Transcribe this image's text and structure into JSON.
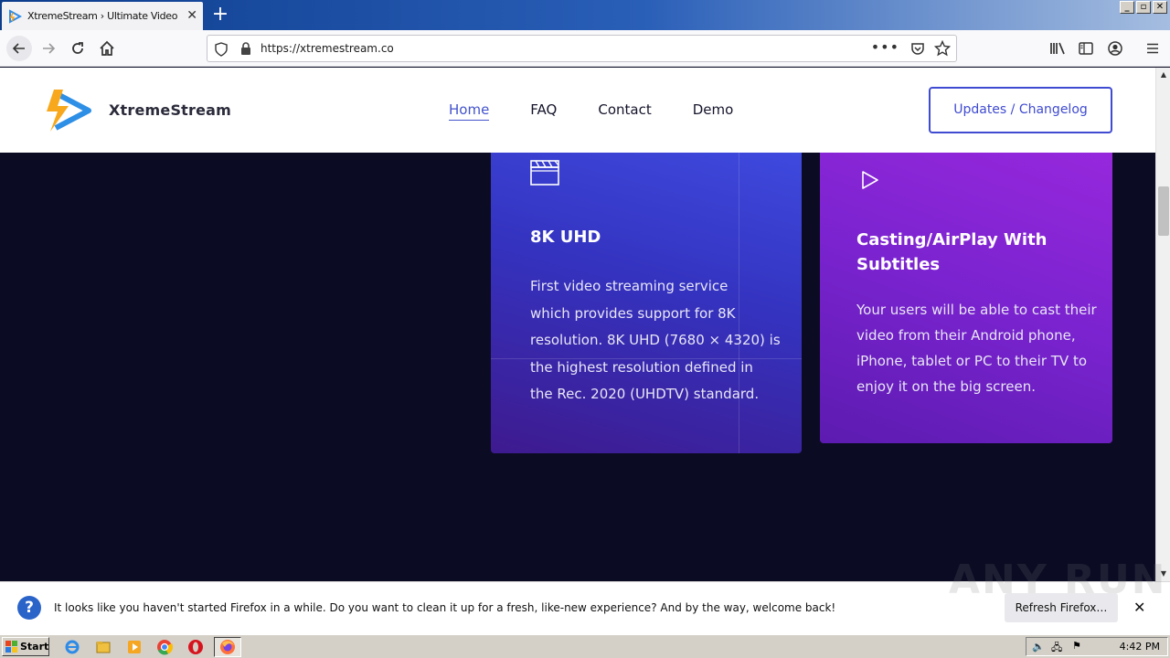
{
  "browser": {
    "tab_title": "XtremeStream › Ultimate Video Stre",
    "url": "https://xtremestream.co",
    "url_more": "•••",
    "new_tab_symbol": "+"
  },
  "window_buttons": [
    "_",
    "▫",
    "✕"
  ],
  "site": {
    "brand": "XtremeStream",
    "nav": [
      "Home",
      "FAQ",
      "Contact",
      "Demo"
    ],
    "active_nav": "Home",
    "cta": "Updates / Changelog"
  },
  "features": [
    {
      "icon": "clapperboard-icon",
      "title": "8K UHD",
      "lines": [
        "First video streaming service",
        "which provides support for 8K",
        "resolution. 8K UHD (7680 × 4320) is",
        "the highest resolution defined in",
        "the Rec. 2020 (UHDTV) standard."
      ]
    },
    {
      "icon": "play-icon",
      "title_lines": [
        "Casting/AirPlay With",
        "Subtitles"
      ],
      "lines": [
        "Your users will be able to cast their",
        "video from their Android phone,",
        "iPhone, tablet or PC to their TV to",
        "enjoy it on the big screen."
      ]
    }
  ],
  "notification": {
    "icon": "help-icon",
    "icon_glyph": "?",
    "text": "It looks like you haven't started Firefox in a while. Do you want to clean it up for a fresh, like-new experience? And by the way, welcome back!",
    "button": "Refresh Firefox…",
    "close": "✕"
  },
  "watermark": "ANY RUN",
  "taskbar": {
    "start": "Start",
    "clock": "4:42 PM"
  },
  "colors": {
    "accent": "#3f4bd1",
    "dark_bg": "#0b0c24",
    "card_blue": "#3433c0",
    "card_purple": "#7a23cf"
  }
}
